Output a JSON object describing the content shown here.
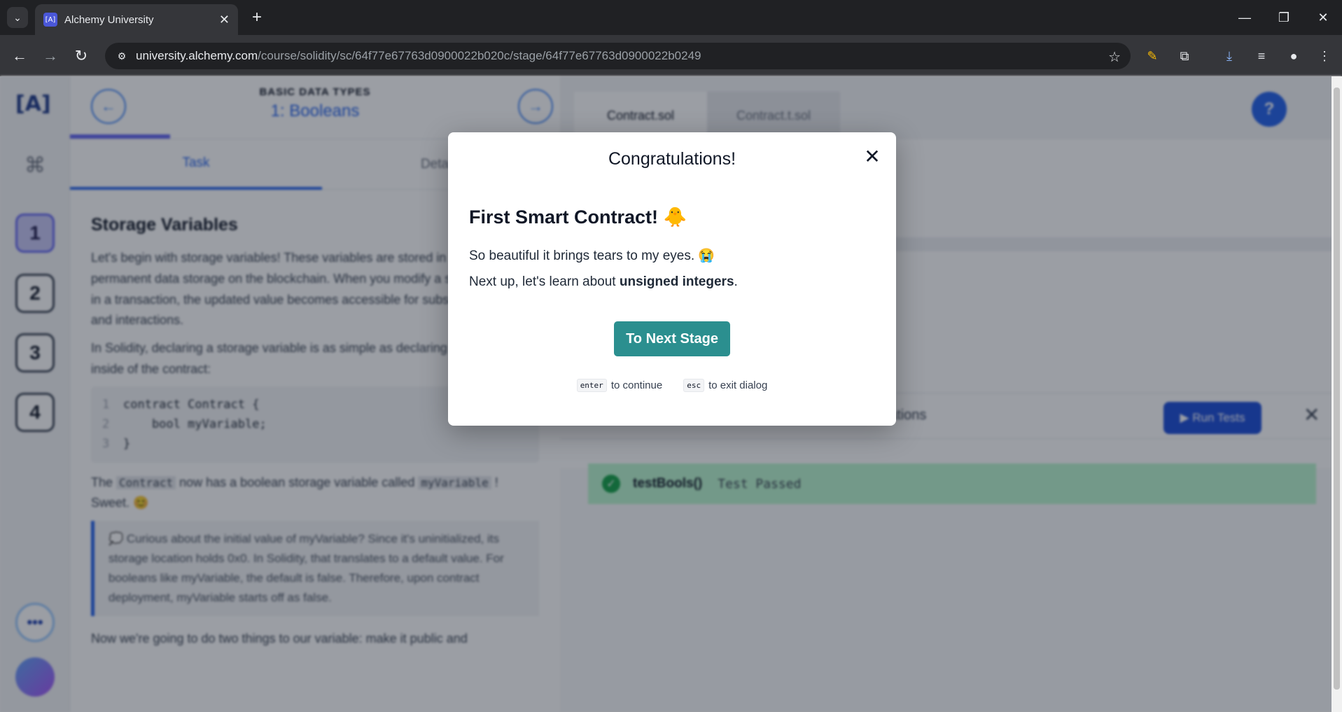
{
  "browser": {
    "tab_title": "Alchemy University",
    "favicon_text": "[A]",
    "url_host": "university.alchemy.com",
    "url_path": "/course/solidity/sc/64f77e67763d0900022b020c/stage/64f77e67763d0900022b0249"
  },
  "sidebar": {
    "logo": "[A]",
    "stages": [
      "1",
      "2",
      "3",
      "4"
    ],
    "more_label": "•••"
  },
  "lesson": {
    "kicker": "BASIC DATA TYPES",
    "name": "1: Booleans",
    "tabs": [
      "Task",
      "Details"
    ],
    "heading": "Storage Variables",
    "para1": "Let's begin with storage variables! These variables are stored in the contract's permanent data storage on the blockchain. When you modify a storage variable in a transaction, the updated value becomes accessible for subsequent reads and interactions.",
    "para2": "In Solidity, declaring a storage variable is as simple as declaring a variable inside of the contract:",
    "code": [
      {
        "num": "1",
        "text": "contract Contract {"
      },
      {
        "num": "2",
        "text": "    bool myVariable;"
      },
      {
        "num": "3",
        "text": "}"
      }
    ],
    "para3_a": "The",
    "para3_code": "Contract",
    "para3_b": "now has a boolean storage variable called",
    "para3_code2": "myVariable",
    "para3_c": "! Sweet. 😊",
    "callout": "💭 Curious about the initial value of myVariable? Since it's uninitialized, its storage location holds 0x0. In Solidity, that translates to a default value. For booleans like myVariable, the default is false. Therefore, upon contract deployment, myVariable starts off as false.",
    "para4": "Now we're going to do two things to our variable: make it public and"
  },
  "editor": {
    "file_tabs": [
      "Contract.sol",
      "Contract.t.sol"
    ],
    "help": "?",
    "tests_label": "ations",
    "run_tests": "Run Tests",
    "test_name": "testBools()",
    "test_status": "Test Passed"
  },
  "modal": {
    "title": "Congratulations!",
    "heading": "First Smart Contract! 🐥",
    "line1": "So beautiful it brings tears to my eyes. 😭",
    "line2_prefix": "Next up, let's learn about ",
    "line2_bold": "unsigned integers",
    "line2_suffix": ".",
    "cta": "To Next Stage",
    "hint_enter_key": "enter",
    "hint_enter_text": "to continue",
    "hint_esc_key": "esc",
    "hint_esc_text": "to exit dialog"
  }
}
